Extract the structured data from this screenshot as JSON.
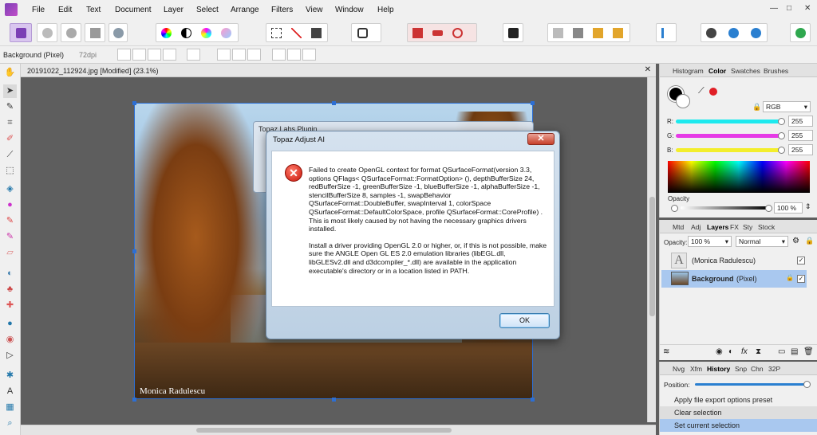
{
  "menubar": {
    "items": [
      "File",
      "Edit",
      "Text",
      "Document",
      "Layer",
      "Select",
      "Arrange",
      "Filters",
      "View",
      "Window",
      "Help"
    ],
    "window_controls": {
      "minimize": "—",
      "maximize": "□",
      "close": "✕"
    }
  },
  "context_bar": {
    "layer_label": "Background (Pixel)",
    "dpi": "72dpi"
  },
  "document": {
    "tab_title": "20191022_112924.jpg [Modified] (23.1%)",
    "watermark": "Monica Radulescu"
  },
  "background_dialog": {
    "title": "Topaz Labs Plugin"
  },
  "dialog": {
    "title": "Topaz Adjust AI",
    "close_label": "✕",
    "icon": "error-icon",
    "paragraph1": "Failed to create OpenGL context for format QSurfaceFormat(version 3.3, options QFlags< QSurfaceFormat::FormatOption> (), depthBufferSize 24, redBufferSize -1, greenBufferSize -1, blueBufferSize -1, alphaBufferSize -1, stencilBufferSize 8, samples -1, swapBehavior QSurfaceFormat::DoubleBuffer, swapInterval 1, colorSpace QSurfaceFormat::DefaultColorSpace, profile QSurfaceFormat::CoreProfile) .",
    "paragraph2": "This is most likely caused by not having the necessary graphics drivers installed.",
    "paragraph3": "Install a driver providing OpenGL 2.0 or higher, or, if this is not possible, make sure the ANGLE Open GL ES 2.0 emulation libraries (libEGL.dll, libGLESv2.dll and d3dcompiler_*.dll) are available in the application executable's directory or in a location listed in PATH.",
    "ok_label": "OK"
  },
  "color_panel": {
    "tabs": [
      "Histogram",
      "Color",
      "Swatches",
      "Brushes"
    ],
    "active_tab": "Color",
    "model": "RGB",
    "channels": [
      {
        "label": "R:",
        "value": "255",
        "color": "#1de9ee"
      },
      {
        "label": "G:",
        "value": "255",
        "color": "#e63ae6"
      },
      {
        "label": "B:",
        "value": "255",
        "color": "#f3ee2b"
      }
    ],
    "opacity_label": "Opacity",
    "opacity_value": "100 %",
    "accent_red": "#e01f26"
  },
  "layers_panel": {
    "tabs": [
      "Mtd",
      "Adj",
      "Layers",
      "FX",
      "Sty",
      "Stock"
    ],
    "active_tab": "Layers",
    "opacity_label": "Opacity:",
    "opacity_value": "100 %",
    "blend_mode": "Normal",
    "layers": [
      {
        "name": "(Monica Radulescu)",
        "selected": false
      },
      {
        "name": "Background",
        "suffix": "(Pixel)",
        "selected": true
      }
    ]
  },
  "history_panel": {
    "tabs": [
      "Nvg",
      "Xfm",
      "History",
      "Snp",
      "Chn",
      "32P"
    ],
    "active_tab": "History",
    "position_label": "Position:",
    "items": [
      "Apply file export options preset",
      "Clear selection",
      "Set current selection"
    ],
    "selected_index": 2
  }
}
